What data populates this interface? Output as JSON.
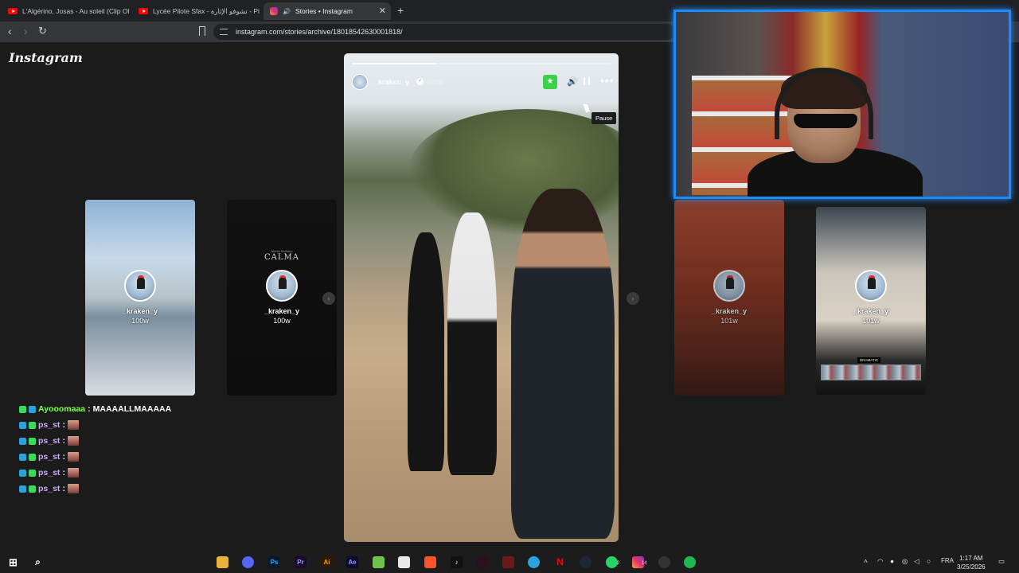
{
  "browser": {
    "tabs": [
      {
        "title": "L'Algérino, Josas - Au soleil (Clip Offi",
        "icon": "youtube-icon",
        "active": false
      },
      {
        "title": "Lycée Pilote Sfax - تشوفو الإثارة - Piste",
        "icon": "youtube-icon",
        "active": false
      },
      {
        "title": "Stories • Instagram",
        "icon": "instagram-icon",
        "active": true
      }
    ],
    "new_tab": "+",
    "close": "✕",
    "url": "instagram.com/stories/archive/18018542630001818/"
  },
  "instagram": {
    "logo": "Instagram",
    "side_stories": [
      {
        "username": "_kraken_y",
        "age": "100w"
      },
      {
        "username": "_kraken_y",
        "age": "100w",
        "overlay_title": "CALMA",
        "overlay_sub": "Nicola Siciliano"
      },
      {
        "username": "_kraken_y",
        "age": "101w"
      },
      {
        "username": "_kraken_y",
        "age": "101w",
        "overlay_tag": "DRAMATIC"
      }
    ],
    "main_story": {
      "username": "_kraken_y",
      "age": "101w",
      "progress": 0.33,
      "tooltip": "Pause",
      "prev": "‹",
      "next": "›"
    }
  },
  "chat": [
    {
      "user": "Ayooomaaa",
      "message": "MAAAALLMAAAAA",
      "color": "#7cff4a"
    },
    {
      "user": "ps_st",
      "message": "",
      "color": "#cda6ff"
    },
    {
      "user": "ps_st",
      "message": "",
      "color": "#cda6ff"
    },
    {
      "user": "ps_st",
      "message": "",
      "color": "#cda6ff"
    },
    {
      "user": "ps_st",
      "message": "",
      "color": "#cda6ff"
    },
    {
      "user": "ps_st",
      "message": "",
      "color": "#cda6ff"
    }
  ],
  "taskbar": {
    "apps": [
      "Ps",
      "Pr",
      "Ai",
      "Ae"
    ],
    "badges": {
      "whatsapp": "2",
      "instagram": "14"
    },
    "language": "FRA",
    "time": "1:17 AM",
    "date": "3/25/2026"
  }
}
